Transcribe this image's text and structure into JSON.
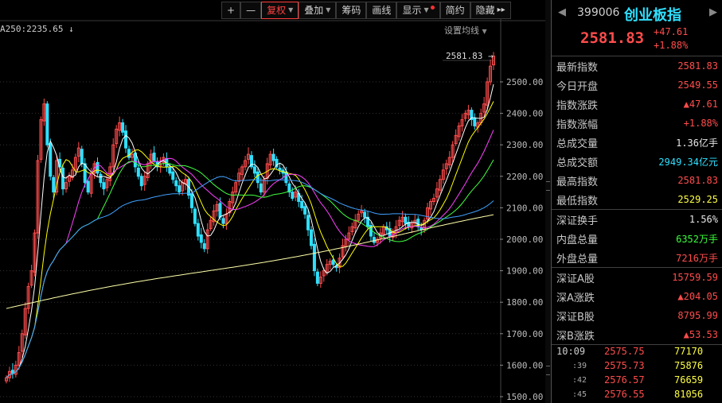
{
  "toolbar": {
    "plus": "+",
    "minus": "—",
    "fuquan": "复权",
    "diejia": "叠加",
    "chouma": "筹码",
    "huaxian": "画线",
    "xianshi": "显示",
    "jianyue": "简约",
    "yincang": "隐藏",
    "more": "▸▸"
  },
  "chart_header": {
    "ma_label": "A250:2235.65 ↓",
    "ma_setting": "设置均线"
  },
  "chart_data": {
    "type": "candlestick",
    "current_tag": "2581.83",
    "ylim": [
      1500,
      2600
    ],
    "y_ticks": [
      "2500.00",
      "2400.00",
      "2300.00",
      "2200.00",
      "2100.00",
      "2000.00",
      "1900.00",
      "1800.00",
      "1700.00",
      "1600.00",
      "1500.00"
    ],
    "y_values": [
      2500,
      2400,
      2300,
      2200,
      2100,
      2000,
      1900,
      1800,
      1700,
      1600,
      1500
    ],
    "closes": [
      1560,
      1580,
      1575,
      1600,
      1640,
      1700,
      1780,
      1850,
      1900,
      2020,
      2250,
      2380,
      2430,
      2300,
      2200,
      2150,
      2250,
      2230,
      2160,
      2180,
      2200,
      2220,
      2260,
      2290,
      2240,
      2180,
      2150,
      2210,
      2240,
      2210,
      2180,
      2160,
      2190,
      2230,
      2300,
      2350,
      2370,
      2340,
      2290,
      2260,
      2270,
      2230,
      2200,
      2170,
      2200,
      2240,
      2270,
      2250,
      2230,
      2240,
      2260,
      2230,
      2210,
      2190,
      2170,
      2150,
      2180,
      2190,
      2140,
      2100,
      2050,
      2010,
      1990,
      1970,
      2030,
      2060,
      2090,
      2110,
      2070,
      2050,
      2080,
      2120,
      2150,
      2180,
      2210,
      2230,
      2250,
      2270,
      2230,
      2210,
      2180,
      2150,
      2190,
      2240,
      2270,
      2250,
      2230,
      2220,
      2210,
      2180,
      2150,
      2130,
      2150,
      2120,
      2100,
      2080,
      2030,
      1980,
      1900,
      1860,
      1880,
      1900,
      1920,
      1930,
      1920,
      1910,
      1940,
      1980,
      2000,
      2020,
      2040,
      2060,
      2080,
      2090,
      2070,
      2040,
      2010,
      1990,
      2000,
      2020,
      2040,
      2030,
      2010,
      2020,
      2040,
      2060,
      2070,
      2050,
      2040,
      2050,
      2060,
      2040,
      2030,
      2060,
      2100,
      2120,
      2130,
      2160,
      2190,
      2220,
      2240,
      2260,
      2300,
      2330,
      2360,
      2380,
      2400,
      2410,
      2380,
      2360,
      2370,
      2400,
      2430,
      2500,
      2550,
      2582
    ],
    "ma_series": [
      {
        "color": "#ffffff",
        "period": 5
      },
      {
        "color": "#ffff00",
        "period": 10
      },
      {
        "color": "#ff40ff",
        "period": 20
      },
      {
        "color": "#40ff40",
        "period": 30
      },
      {
        "color": "#40a0ff",
        "period": 60
      },
      {
        "color": "#ffffaa",
        "period": 120
      }
    ]
  },
  "quote": {
    "code": "399006",
    "name": "创业板指",
    "price": "2581.83",
    "change": "+47.61",
    "change_pct": "+1.88%"
  },
  "stats_group1": [
    {
      "label": "最新指数",
      "value": "2581.83",
      "color": "red"
    },
    {
      "label": "今日开盘",
      "value": "2549.55",
      "color": "red"
    },
    {
      "label": "指数涨跌",
      "value": "▲47.61",
      "color": "red"
    },
    {
      "label": "指数涨幅",
      "value": "+1.88%",
      "color": "red"
    },
    {
      "label": "总成交量",
      "value": "1.36亿手",
      "color": "white"
    },
    {
      "label": "总成交额",
      "value": "2949.34亿元",
      "color": "cyan"
    },
    {
      "label": "最高指数",
      "value": "2581.83",
      "color": "red"
    },
    {
      "label": "最低指数",
      "value": "2529.25",
      "color": "yellow"
    }
  ],
  "stats_group2": [
    {
      "label": "深证换手",
      "value": "1.56%",
      "color": "white"
    },
    {
      "label": "内盘总量",
      "value": "6352万手",
      "color": "green"
    },
    {
      "label": "外盘总量",
      "value": "7216万手",
      "color": "red"
    }
  ],
  "stats_group3": [
    {
      "label": "深证A股",
      "value": "15759.59",
      "color": "red"
    },
    {
      "label": "深A涨跌",
      "value": "▲204.05",
      "color": "red"
    },
    {
      "label": "深证B股",
      "value": "8795.99",
      "color": "red"
    },
    {
      "label": "深B涨跌",
      "value": "▲53.53",
      "color": "red"
    }
  ],
  "ticks": [
    {
      "time": "10:09",
      "price": "2575.75",
      "vol": "77170"
    },
    {
      "time": ":39",
      "price": "2575.73",
      "vol": "75876"
    },
    {
      "time": ":42",
      "price": "2576.57",
      "vol": "76659"
    },
    {
      "time": ":45",
      "price": "2576.55",
      "vol": "81056"
    }
  ]
}
